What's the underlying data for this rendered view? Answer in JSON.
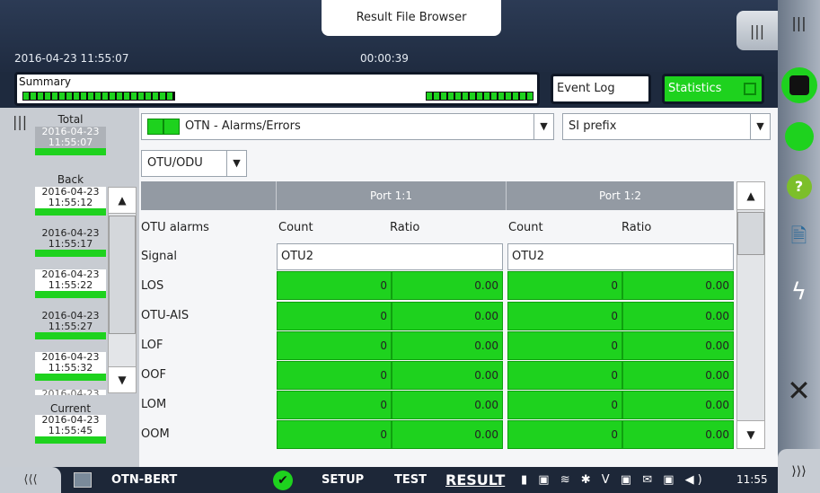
{
  "window": {
    "title": "Result File Browser",
    "datetime": "2016-04-23 11:55:07",
    "elapsed": "00:00:39"
  },
  "summary": {
    "label": "Summary"
  },
  "buttons": {
    "event_log": "Event Log",
    "statistics": "Statistics"
  },
  "left": {
    "total_label": "Total",
    "total_ts": "2016-04-23 11:55:07",
    "back_label": "Back",
    "back_items": [
      "2016-04-23 11:55:12",
      "2016-04-23 11:55:17",
      "2016-04-23 11:55:22",
      "2016-04-23 11:55:27",
      "2016-04-23 11:55:32"
    ],
    "back_partial": "2016-04-23",
    "current_label": "Current",
    "current_ts": "2016-04-23 11:55:45"
  },
  "selectors": {
    "category": "OTN - Alarms/Errors",
    "prefix": "SI prefix",
    "layer": "OTU/ODU"
  },
  "table": {
    "ports": [
      "Port 1:1",
      "Port 1:2"
    ],
    "section_label": "OTU alarms",
    "col_count": "Count",
    "col_ratio": "Ratio",
    "signal_label": "Signal",
    "signal_values": [
      "OTU2",
      "OTU2"
    ],
    "rows": [
      {
        "name": "LOS",
        "p1_count": "0",
        "p1_ratio": "0.00",
        "p2_count": "0",
        "p2_ratio": "0.00"
      },
      {
        "name": "OTU-AIS",
        "p1_count": "0",
        "p1_ratio": "0.00",
        "p2_count": "0",
        "p2_ratio": "0.00"
      },
      {
        "name": "LOF",
        "p1_count": "0",
        "p1_ratio": "0.00",
        "p2_count": "0",
        "p2_ratio": "0.00"
      },
      {
        "name": "OOF",
        "p1_count": "0",
        "p1_ratio": "0.00",
        "p2_count": "0",
        "p2_ratio": "0.00"
      },
      {
        "name": "LOM",
        "p1_count": "0",
        "p1_ratio": "0.00",
        "p2_count": "0",
        "p2_ratio": "0.00"
      },
      {
        "name": "OOM",
        "p1_count": "0",
        "p1_ratio": "0.00",
        "p2_count": "0",
        "p2_ratio": "0.00"
      }
    ]
  },
  "bottom": {
    "app_name": "OTN-BERT",
    "setup": "SETUP",
    "test": "TEST",
    "result": "RESULT",
    "time": "11:55"
  },
  "colors": {
    "ok_green": "#1ed21e",
    "header_grey": "#939aa3",
    "dark_bar": "#1d2738"
  }
}
